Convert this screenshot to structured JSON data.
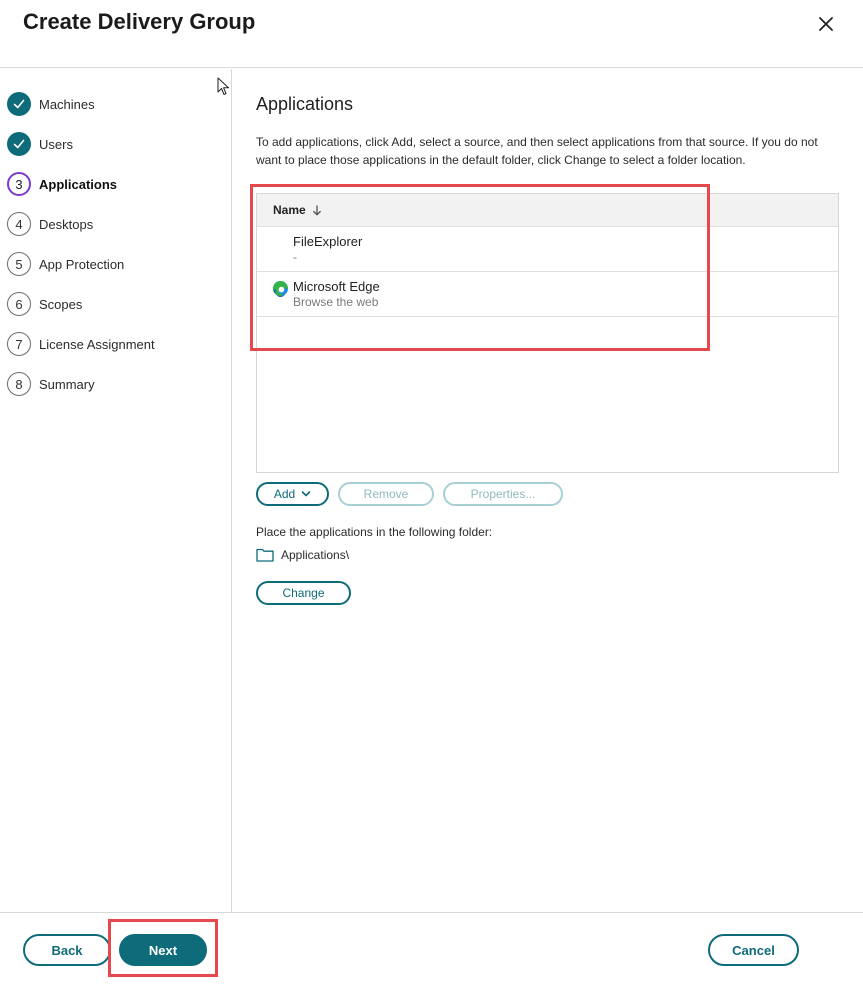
{
  "dialog": {
    "title": "Create Delivery Group"
  },
  "steps": [
    {
      "num": "1",
      "label": "Machines",
      "state": "done"
    },
    {
      "num": "2",
      "label": "Users",
      "state": "done"
    },
    {
      "num": "3",
      "label": "Applications",
      "state": "active"
    },
    {
      "num": "4",
      "label": "Desktops",
      "state": "todo"
    },
    {
      "num": "5",
      "label": "App Protection",
      "state": "todo"
    },
    {
      "num": "6",
      "label": "Scopes",
      "state": "todo"
    },
    {
      "num": "7",
      "label": "License Assignment",
      "state": "todo"
    },
    {
      "num": "8",
      "label": "Summary",
      "state": "todo"
    }
  ],
  "main": {
    "title": "Applications",
    "description": "To add applications, click Add, select a source, and then select applications from that source. If you do not want to place those applications in the default folder, click Change to select a folder location.",
    "table": {
      "column": "Name",
      "rows": [
        {
          "name": "FileExplorer",
          "desc": "-",
          "icon": "none"
        },
        {
          "name": "Microsoft Edge",
          "desc": "Browse the web",
          "icon": "edge-icon"
        }
      ]
    },
    "buttons": {
      "add": "Add",
      "remove": "Remove",
      "properties": "Properties..."
    },
    "folder": {
      "label": "Place the applications in the following folder:",
      "path": "Applications\\",
      "change": "Change"
    }
  },
  "footer": {
    "back": "Back",
    "next": "Next",
    "cancel": "Cancel"
  },
  "colors": {
    "accent": "#0e6b7a",
    "active_step": "#7a3ad1",
    "highlight": "#e5484d"
  }
}
